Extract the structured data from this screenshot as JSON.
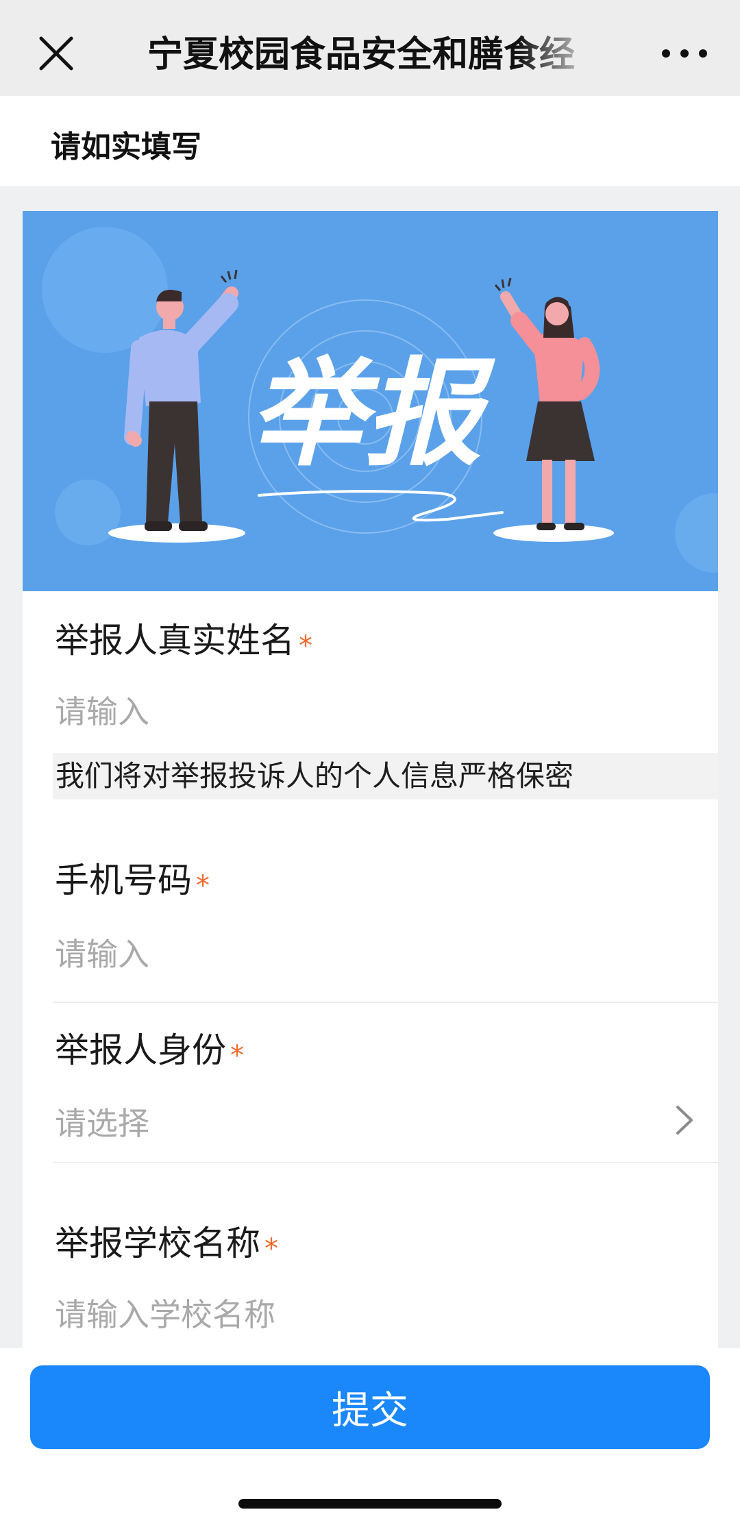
{
  "topbar": {
    "title": "宁夏校园食品安全和膳食经",
    "close_icon": "close-icon",
    "more_icon": "more-dots-icon"
  },
  "notice": {
    "text": "请如实填写"
  },
  "banner": {
    "text": "举报",
    "background_color": "#5aa1ea"
  },
  "form": {
    "name": {
      "label": "举报人真实姓名",
      "required_mark": "*",
      "placeholder": "请输入"
    },
    "privacy_note": "我们将对举报投诉人的个人信息严格保密",
    "phone": {
      "label": "手机号码",
      "required_mark": "*",
      "placeholder": "请输入"
    },
    "identity": {
      "label": "举报人身份",
      "required_mark": "*",
      "placeholder": "请选择"
    },
    "school": {
      "label": "举报学校名称",
      "required_mark": "*",
      "placeholder": "请输入学校名称"
    }
  },
  "submit": {
    "label": "提交",
    "color": "#1a87fb"
  },
  "colors": {
    "required": "#f06a2e",
    "placeholder": "#a9a9a9"
  }
}
